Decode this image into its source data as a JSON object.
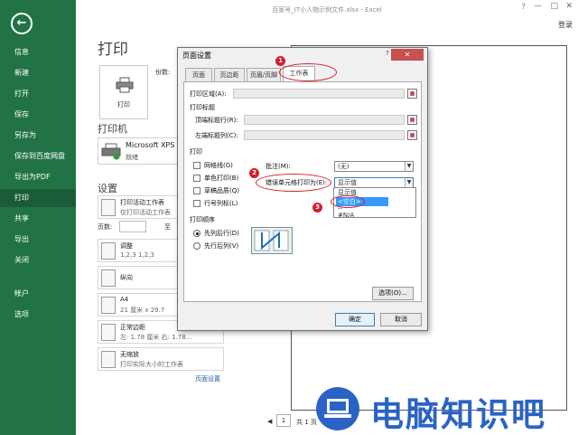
{
  "window": {
    "title": "百家号_IT小人物示例文件.xlsx - Excel",
    "help": "?",
    "minimize": "—",
    "restore": "□",
    "close": "✕",
    "signin": "登录"
  },
  "sidebar": {
    "back_icon": "arrow-left-icon",
    "items": [
      {
        "label": "信息"
      },
      {
        "label": "新建"
      },
      {
        "label": "打开"
      },
      {
        "label": "保存"
      },
      {
        "label": "另存为"
      },
      {
        "label": "保存到百度网盘"
      },
      {
        "label": "导出为PDF"
      },
      {
        "label": "打印",
        "active": true
      },
      {
        "label": "共享"
      },
      {
        "label": "导出"
      },
      {
        "label": "关闭"
      },
      {
        "label": "帐户"
      },
      {
        "label": "选项"
      }
    ]
  },
  "print": {
    "title": "打印",
    "print_button": "打印",
    "copies_label": "份数:",
    "printer_heading": "打印机",
    "printer_name": "Microsoft XPS",
    "printer_status": "就绪",
    "settings_heading": "设置",
    "settings": [
      {
        "l1": "打印活动工作表",
        "l2": "仅打印活动工作表"
      },
      {
        "l1": "调整",
        "l2": "1,2,3    1,2,3"
      },
      {
        "l1": "纵向",
        "l2": ""
      },
      {
        "l1": "A4",
        "l2": "21 厘米 x 29.7"
      },
      {
        "l1": "正常边距",
        "l2": "左: 1.78 厘米   右: 1.78..."
      },
      {
        "l1": "无缩放",
        "l2": "打印实际大小的工作表"
      }
    ],
    "pages_label": "页数:",
    "pages_to": "至",
    "page_setup_link": "页面设置",
    "page_current": "1",
    "page_total": "共 1 页"
  },
  "dialog": {
    "title": "页面设置",
    "close": "✕",
    "help": "?",
    "tabs": [
      {
        "label": "页面"
      },
      {
        "label": "页边距"
      },
      {
        "label": "页眉/页脚"
      },
      {
        "label": "工作表",
        "active": true
      }
    ],
    "print_area_label": "打印区域(A):",
    "print_titles_heading": "打印标题",
    "top_rows_label": "顶端标题行(R):",
    "left_cols_label": "左端标题列(C):",
    "print_heading": "打印",
    "checkboxes": [
      {
        "label": "网格线(G)",
        "checked": false
      },
      {
        "label": "单色打印(B)",
        "checked": false
      },
      {
        "label": "草稿品质(Q)",
        "checked": false
      },
      {
        "label": "行号列标(L)",
        "checked": false
      }
    ],
    "comments_label": "批注(M):",
    "comments_value": "(无)",
    "errors_label": "错误单元格打印为(E):",
    "errors_value": "显示值",
    "errors_options": [
      "显示值",
      "<空白>",
      "--",
      "#N/A"
    ],
    "errors_selected": "<空白>",
    "order_heading": "打印顺序",
    "order_options": [
      {
        "label": "先列后行(D)",
        "checked": true
      },
      {
        "label": "先行后列(V)",
        "checked": false
      }
    ],
    "options_button": "选项(O)...",
    "ok_button": "确定",
    "cancel_button": "取消"
  },
  "annotations": [
    "1",
    "2",
    "3"
  ],
  "watermark": {
    "text": "电脑知识吧",
    "icon": "laptop-icon"
  },
  "colors": {
    "excel_green": "#217346",
    "annotation_red": "#d21f2b",
    "watermark_blue": "#2a63c5"
  }
}
